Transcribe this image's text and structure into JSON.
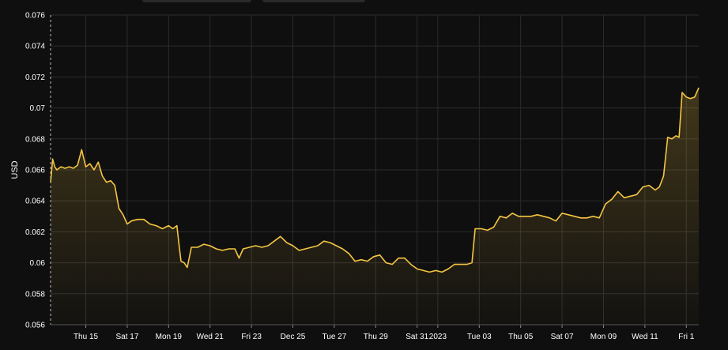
{
  "chart_data": {
    "type": "area",
    "title": "",
    "xlabel": "",
    "ylabel": "USD",
    "ylim": [
      0.056,
      0.076
    ],
    "yticks": [
      0.056,
      0.058,
      0.06,
      0.062,
      0.064,
      0.066,
      0.068,
      0.07,
      0.072,
      0.074,
      0.076
    ],
    "ytick_labels": [
      "0.056",
      "0.058",
      "0.06",
      "0.062",
      "0.064",
      "0.066",
      "0.068",
      "0.07",
      "0.072",
      "0.074",
      "0.076"
    ],
    "x_ticks": [
      {
        "label": "Thu 15",
        "day": 1.7
      },
      {
        "label": "Sat 17",
        "day": 3.7
      },
      {
        "label": "Mon 19",
        "day": 5.7
      },
      {
        "label": "Wed 21",
        "day": 7.7
      },
      {
        "label": "Fri 23",
        "day": 9.7
      },
      {
        "label": "Dec 25",
        "day": 11.7
      },
      {
        "label": "Tue 27",
        "day": 13.7
      },
      {
        "label": "Thu 29",
        "day": 15.7
      },
      {
        "label": "Sat 31",
        "day": 17.7
      },
      {
        "label": "2023",
        "day": 18.7
      },
      {
        "label": "Tue 03",
        "day": 20.7
      },
      {
        "label": "Thu 05",
        "day": 22.7
      },
      {
        "label": "Sat 07",
        "day": 24.7
      },
      {
        "label": "Mon 09",
        "day": 26.7
      },
      {
        "label": "Wed 11",
        "day": 28.7
      },
      {
        "label": "Fri 1",
        "day": 30.7
      }
    ],
    "xlim": [
      0,
      31.3
    ],
    "grid": true,
    "legend": "none",
    "line_color": "#f5c542",
    "background": "#0f0f0f",
    "grid_color": "#2c2c2c",
    "series": [
      {
        "x": [
          0,
          0.1,
          0.2,
          0.3,
          0.5,
          0.7,
          0.9,
          1.1,
          1.3,
          1.5,
          1.7,
          1.9,
          2.1,
          2.3,
          2.5,
          2.7,
          2.9,
          3.1,
          3.3,
          3.5,
          3.7,
          3.9,
          4.2,
          4.5,
          4.8,
          5.1,
          5.4,
          5.7,
          5.9,
          6.1,
          6.2,
          6.3,
          6.45,
          6.6,
          6.8,
          7.1,
          7.4,
          7.7,
          8.0,
          8.3,
          8.6,
          8.9,
          9.1,
          9.3,
          9.6,
          9.9,
          10.2,
          10.5,
          10.8,
          11.1,
          11.4,
          11.7,
          12.0,
          12.3,
          12.6,
          12.9,
          13.2,
          13.5,
          13.8,
          14.1,
          14.4,
          14.7,
          15.0,
          15.3,
          15.6,
          15.9,
          16.2,
          16.5,
          16.8,
          17.1,
          17.4,
          17.7,
          18.0,
          18.3,
          18.6,
          18.9,
          19.2,
          19.5,
          19.8,
          20.1,
          20.35,
          20.5,
          20.8,
          21.1,
          21.4,
          21.7,
          22.0,
          22.3,
          22.6,
          22.9,
          23.2,
          23.5,
          23.8,
          24.1,
          24.4,
          24.7,
          25.0,
          25.3,
          25.6,
          25.9,
          26.2,
          26.5,
          26.8,
          27.1,
          27.4,
          27.7,
          28.0,
          28.3,
          28.6,
          28.9,
          29.2,
          29.4,
          29.6,
          29.8,
          30.0,
          30.2,
          30.35,
          30.5,
          30.7,
          30.9,
          31.1,
          31.3
        ],
        "values": [
          0.0652,
          0.0667,
          0.0662,
          0.066,
          0.0662,
          0.0661,
          0.0662,
          0.0661,
          0.0663,
          0.0673,
          0.0662,
          0.0664,
          0.066,
          0.0665,
          0.0656,
          0.0652,
          0.0653,
          0.065,
          0.0635,
          0.0631,
          0.0625,
          0.0627,
          0.0628,
          0.0628,
          0.0625,
          0.0624,
          0.0622,
          0.0624,
          0.0622,
          0.0624,
          0.0612,
          0.0601,
          0.06,
          0.0597,
          0.061,
          0.061,
          0.0612,
          0.0611,
          0.0609,
          0.0608,
          0.0609,
          0.0609,
          0.0603,
          0.0609,
          0.061,
          0.0611,
          0.061,
          0.0611,
          0.0614,
          0.0617,
          0.0613,
          0.0611,
          0.0608,
          0.0609,
          0.061,
          0.0611,
          0.0614,
          0.0613,
          0.0611,
          0.0609,
          0.0606,
          0.0601,
          0.0602,
          0.0601,
          0.0604,
          0.0605,
          0.06,
          0.0599,
          0.0603,
          0.0603,
          0.0599,
          0.0596,
          0.0595,
          0.0594,
          0.0595,
          0.0594,
          0.0596,
          0.0599,
          0.0599,
          0.0599,
          0.06,
          0.0622,
          0.0622,
          0.0621,
          0.0623,
          0.063,
          0.0629,
          0.0632,
          0.063,
          0.063,
          0.063,
          0.0631,
          0.063,
          0.0629,
          0.0627,
          0.0632,
          0.0631,
          0.063,
          0.0629,
          0.0629,
          0.063,
          0.0629,
          0.0638,
          0.0641,
          0.0646,
          0.0642,
          0.0643,
          0.0644,
          0.0649,
          0.065,
          0.0647,
          0.0649,
          0.0656,
          0.0681,
          0.068,
          0.0682,
          0.0681,
          0.071,
          0.0707,
          0.0706,
          0.0707,
          0.0713
        ]
      }
    ]
  }
}
